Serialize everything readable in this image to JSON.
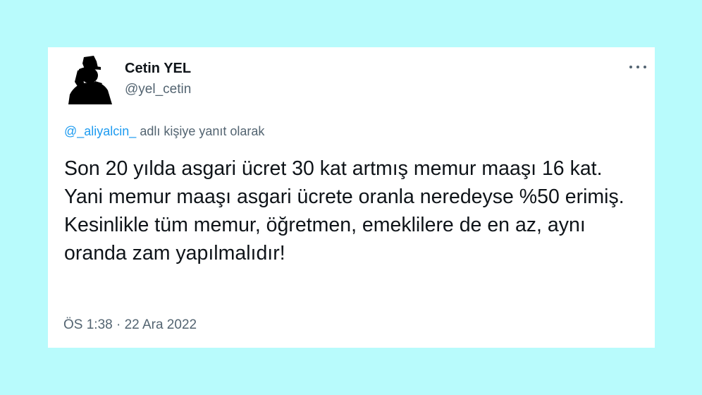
{
  "tweet": {
    "display_name": "Cetin YEL",
    "handle": "@yel_cetin",
    "reply_mention": "@_aliyalcin_",
    "reply_suffix": "adlı kişiye yanıt olarak",
    "text": "Son 20 yılda asgari ücret 30 kat artmış memur maaşı 16 kat. Yani memur maaşı asgari ücrete oranla neredeyse %50 erimiş. Kesinlikle tüm memur, öğretmen, emeklilere de en az, aynı oranda zam yapılmalıdır!",
    "timestamp": "ÖS 1:38 · 22 Ara 2022"
  },
  "icons": {
    "more": "more-horizontal-icon",
    "avatar": "silhouette-avatar"
  },
  "colors": {
    "background": "#b8fbfc",
    "card": "#ffffff",
    "link": "#1d9bf0",
    "text": "#0f1419",
    "muted": "#536471"
  }
}
